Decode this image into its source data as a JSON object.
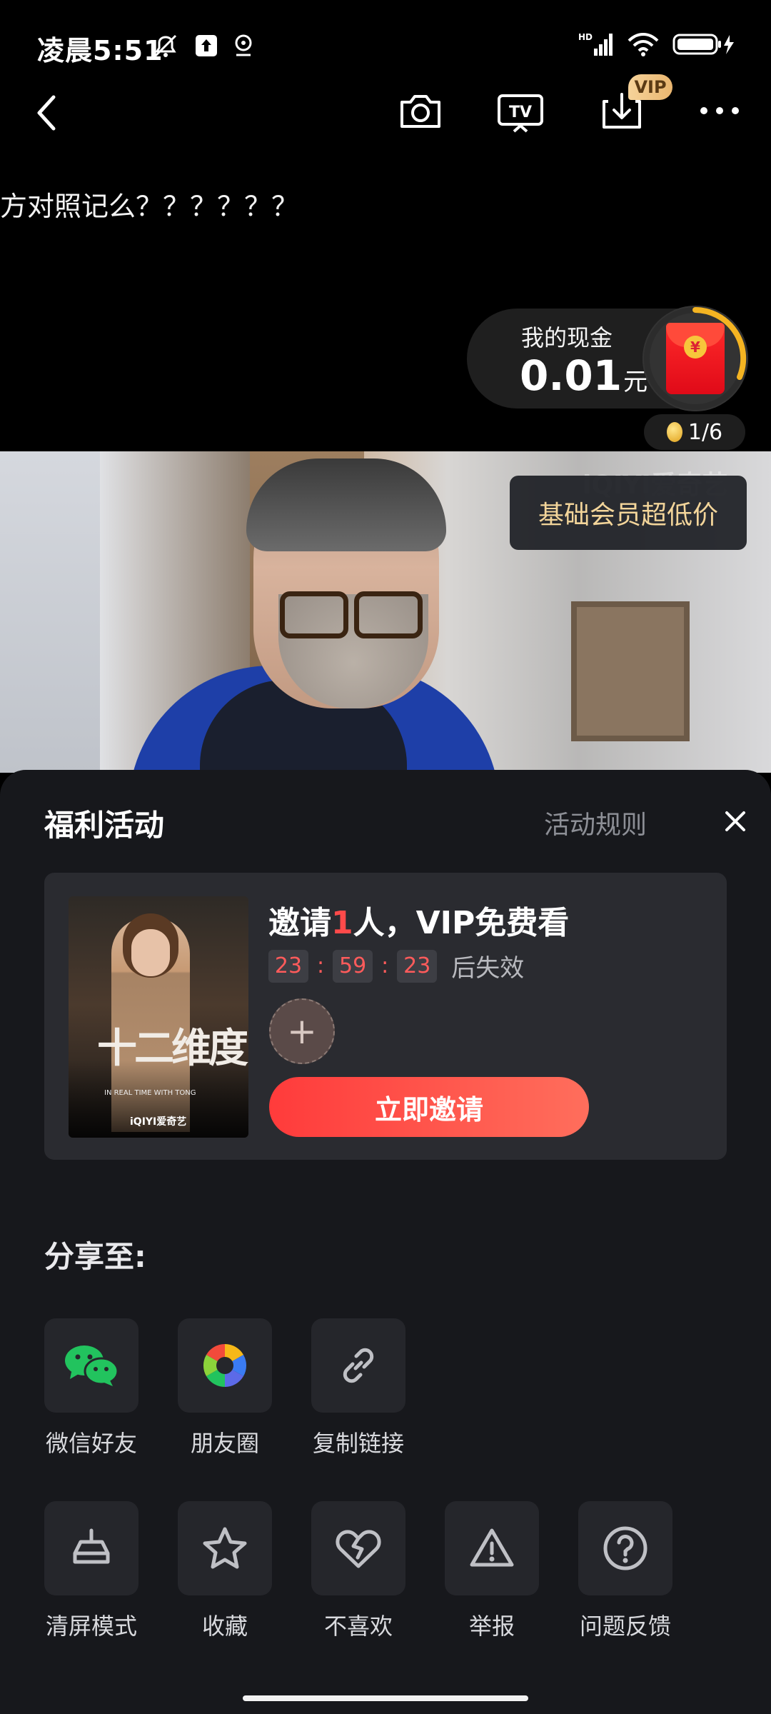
{
  "status_bar": {
    "time": "凌晨5:51",
    "network": "HD"
  },
  "toolbar": {
    "back_icon": "chevron-left-icon",
    "camera_icon": "camera-icon",
    "cast_label": "TV",
    "download_vip_tag": "VIP",
    "more_icon": "more-dots-icon"
  },
  "comment": {
    "text": "方对照记么？？？？？？"
  },
  "cash": {
    "label": "我的现金",
    "amount": "0.01",
    "unit": "元",
    "redpacket_symbol": "¥",
    "progress": "1/6"
  },
  "video": {
    "watermark": "iQIYI爱奇艺",
    "promo": "基础会员超低价"
  },
  "sheet": {
    "title": "福利活动",
    "rules": "活动规则",
    "invite": {
      "title_prefix": "邀请",
      "title_count": "1",
      "title_suffix": "人，VIP免费看",
      "timer": [
        "23",
        "59",
        "23"
      ],
      "timer_suffix": "后失效",
      "add_symbol": "+",
      "button": "立即邀请",
      "poster_title": "十二维度",
      "poster_subtitle": "IN REAL TIME WITH TONG",
      "poster_brand": "iQIYI爱奇艺"
    },
    "share_label": "分享至:",
    "share_items": [
      {
        "label": "微信好友",
        "icon": "wechat-icon"
      },
      {
        "label": "朋友圈",
        "icon": "moments-icon"
      },
      {
        "label": "复制链接",
        "icon": "link-icon"
      }
    ],
    "action_items": [
      {
        "label": "清屏模式",
        "icon": "clear-screen-icon"
      },
      {
        "label": "收藏",
        "icon": "star-icon"
      },
      {
        "label": "不喜欢",
        "icon": "broken-heart-icon"
      },
      {
        "label": "举报",
        "icon": "warning-icon"
      },
      {
        "label": "问题反馈",
        "icon": "question-icon"
      }
    ]
  },
  "colors": {
    "accent_red": "#ff4a4a",
    "promo_gold": "#f3d59a",
    "sheet_bg": "#17181c"
  }
}
